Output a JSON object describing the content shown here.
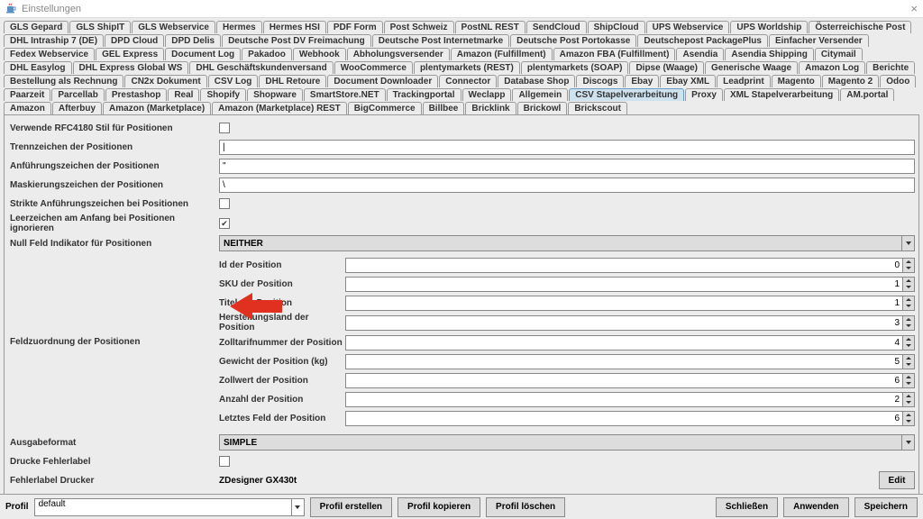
{
  "window": {
    "title": "Einstellungen"
  },
  "tabs": [
    "GLS Gepard",
    "GLS ShipIT",
    "GLS Webservice",
    "Hermes",
    "Hermes HSI",
    "PDF Form",
    "Post Schweiz",
    "PostNL REST",
    "SendCloud",
    "ShipCloud",
    "UPS Webservice",
    "UPS Worldship",
    "Österreichische Post",
    "DHL Intraship 7 (DE)",
    "DPD Cloud",
    "DPD Delis",
    "Deutsche Post DV Freimachung",
    "Deutsche Post Internetmarke",
    "Deutsche Post Portokasse",
    "Deutschepost PackagePlus",
    "Einfacher Versender",
    "Fedex Webservice",
    "GEL Express",
    "Document Log",
    "Pakadoo",
    "Webhook",
    "Abholungsversender",
    "Amazon (Fulfillment)",
    "Amazon FBA (Fulfillment)",
    "Asendia",
    "Asendia Shipping",
    "Citymail",
    "DHL Easylog",
    "DHL Express Global WS",
    "DHL Geschäftskundenversand",
    "WooCommerce",
    "plentymarkets (REST)",
    "plentymarkets (SOAP)",
    "Dipse (Waage)",
    "Generische Waage",
    "Amazon Log",
    "Berichte",
    "Bestellung als Rechnung",
    "CN2x Dokument",
    "CSV Log",
    "DHL Retoure",
    "Document Downloader",
    "Connector",
    "Database Shop",
    "Discogs",
    "Ebay",
    "Ebay XML",
    "Leadprint",
    "Magento",
    "Magento 2",
    "Odoo",
    "Paarzeit",
    "Parcellab",
    "Prestashop",
    "Real",
    "Shopify",
    "Shopware",
    "SmartStore.NET",
    "Trackingportal",
    "Weclapp",
    "Allgemein",
    "CSV Stapelverarbeitung",
    "Proxy",
    "XML Stapelverarbeitung",
    "AM.portal",
    "Amazon",
    "Afterbuy",
    "Amazon (Marketplace)",
    "Amazon (Marketplace) REST",
    "BigCommerce",
    "Billbee",
    "Bricklink",
    "Brickowl",
    "Brickscout"
  ],
  "activeTab": "CSV Stapelverarbeitung",
  "labels": {
    "rfc4180": "Verwende RFC4180 Stil für Positionen",
    "trennzeichen": "Trennzeichen der Positionen",
    "anfuehrung": "Anführungszeichen der Positionen",
    "maskierung": "Maskierungszeichen der Positionen",
    "strikte": "Strikte Anführungszeichen bei Positionen",
    "leerzeichen": "Leerzeichen am Anfang bei Positionen ignorieren",
    "nullfeld": "Null Feld Indikator für Positionen",
    "feldzuordnung": "Feldzuordnung der Positionen",
    "ausgabeformat": "Ausgabeformat",
    "drucke": "Drucke Fehlerlabel",
    "fehlerlabel": "Fehlerlabel Drucker"
  },
  "values": {
    "trennzeichen": "|",
    "anfuehrung": "\"",
    "maskierung": "\\",
    "nullfeld": "NEITHER",
    "ausgabeformat": "SIMPLE",
    "fehlerlabel": "ZDesigner GX430t",
    "leerzeichen_checked": true
  },
  "fields": [
    {
      "label": "Id der Position",
      "value": "0"
    },
    {
      "label": "SKU der Position",
      "value": "1"
    },
    {
      "label": "Titel der Position",
      "value": "1"
    },
    {
      "label": "Herstellungsland der Position",
      "value": "3"
    },
    {
      "label": "Zolltarifnummer der Position",
      "value": "4"
    },
    {
      "label": "Gewicht der Position (kg)",
      "value": "5"
    },
    {
      "label": "Zollwert der Position",
      "value": "6"
    },
    {
      "label": "Anzahl der Position",
      "value": "2"
    },
    {
      "label": "Letztes Feld der Position",
      "value": "6"
    }
  ],
  "buttons": {
    "edit": "Edit",
    "profil_erstellen": "Profil erstellen",
    "profil_kopieren": "Profil kopieren",
    "profil_loeschen": "Profil löschen",
    "schliessen": "Schließen",
    "anwenden": "Anwenden",
    "speichern": "Speichern"
  },
  "profile": {
    "label": "Profil",
    "value": "default"
  }
}
